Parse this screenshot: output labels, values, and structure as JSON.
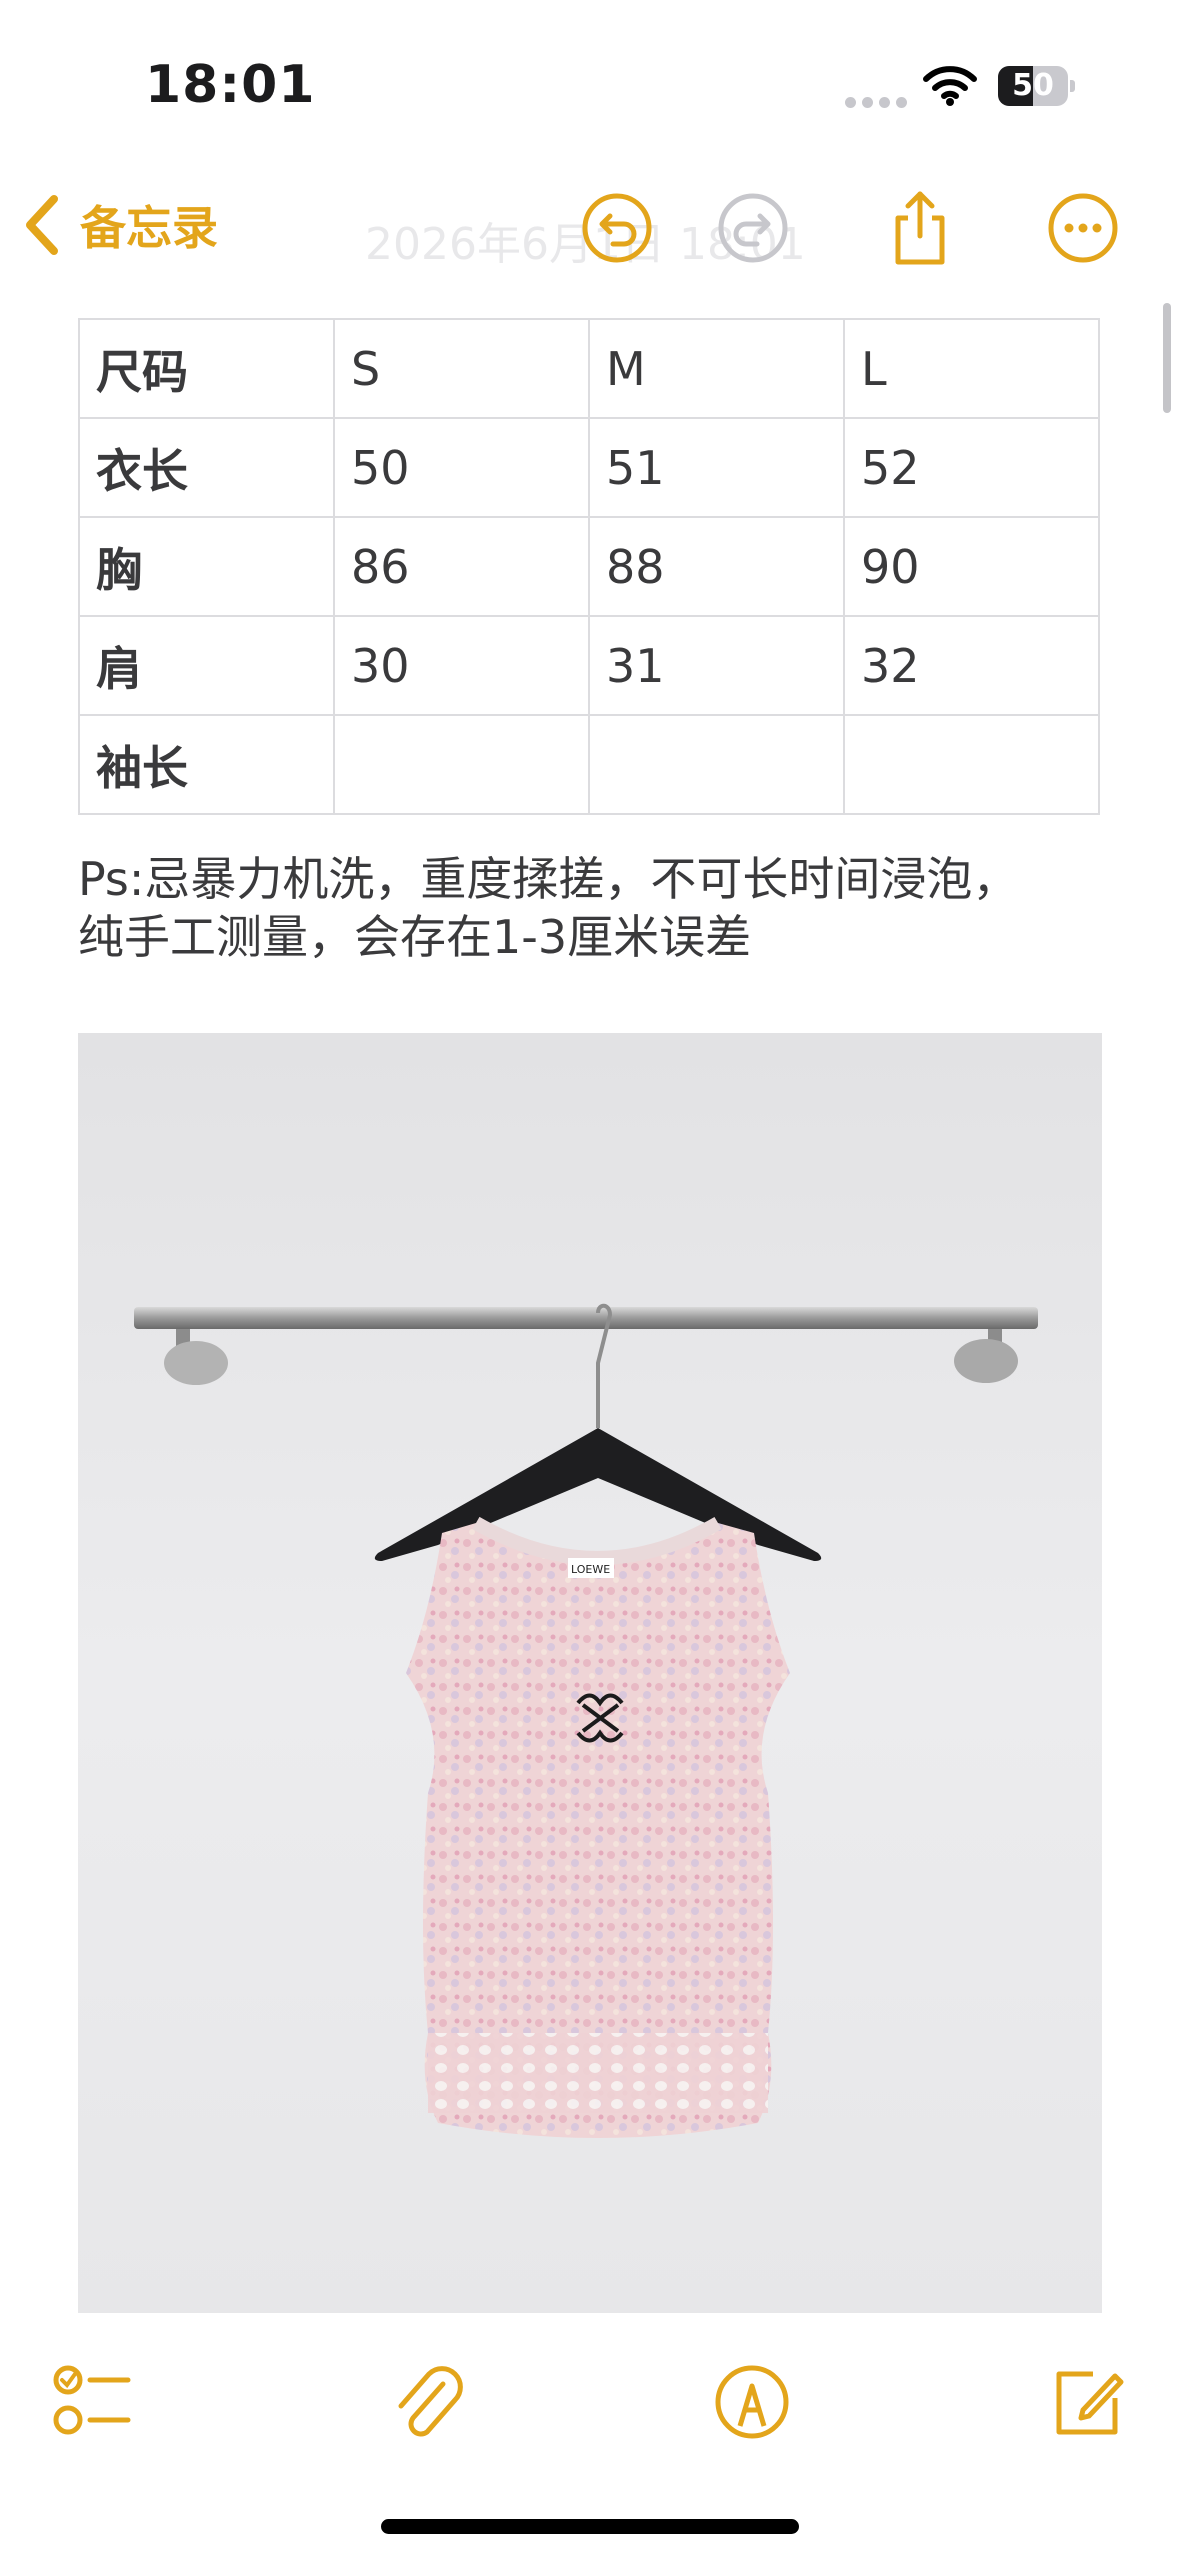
{
  "status_bar": {
    "time": "18:01",
    "battery_level": "50",
    "battery_fraction": 0.5,
    "icons": [
      "signal-dots-icon",
      "wifi-icon",
      "battery-icon"
    ]
  },
  "nav": {
    "back_label": "备忘录",
    "date_title": "2026年6月1日 18:01",
    "icons": [
      "chevron-left-icon",
      "undo-icon",
      "redo-icon",
      "share-icon",
      "more-icon"
    ],
    "accent_color": "#e3a51b"
  },
  "size_table": {
    "rows": [
      [
        "尺码",
        "S",
        "M",
        "L"
      ],
      [
        "衣长",
        "50",
        "51",
        "52"
      ],
      [
        "胸",
        "86",
        "88",
        "90"
      ],
      [
        "肩",
        "30",
        "31",
        "32"
      ],
      [
        "袖长",
        "",
        "",
        ""
      ]
    ]
  },
  "note": {
    "line1": "Ps:忌暴力机洗，重度揉搓，不可长时间浸泡，",
    "line2": "纯手工测量，会存在1-3厘米误差"
  },
  "photo": {
    "garment_label": "LOEWE"
  },
  "toolbar": {
    "icons": [
      "checklist-icon",
      "paperclip-icon",
      "markup-pen-icon",
      "compose-icon"
    ]
  }
}
